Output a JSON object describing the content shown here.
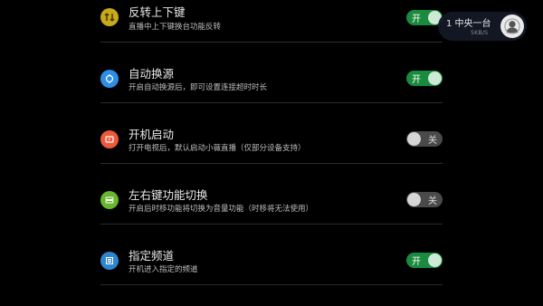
{
  "settings": {
    "items": [
      {
        "title": "反转上下键",
        "desc": "直播中上下键换台功能反转",
        "state": "开",
        "on": true,
        "icon": "reverse-icon",
        "color": "#c8a918"
      },
      {
        "title": "自动换源",
        "desc": "开启自动换源后，即可设置连接超时时长",
        "state": "开",
        "on": true,
        "icon": "auto-switch-source-icon",
        "color": "#2d8ee8"
      },
      {
        "title": "开机启动",
        "desc": "打开电视后，默认启动小薇直播（仅部分设备支持）",
        "state": "关",
        "on": false,
        "icon": "boot-start-icon",
        "color": "#ec5a3a"
      },
      {
        "title": "左右键功能切换",
        "desc": "开启后时移功能将切换为音量功能（时移将无法使用）",
        "state": "关",
        "on": false,
        "icon": "left-right-key-icon",
        "color": "#69b52e"
      },
      {
        "title": "指定频道",
        "desc": "开机进入指定的频道",
        "state": "开",
        "on": true,
        "icon": "channel-list-icon",
        "color": "#2f86cf"
      }
    ]
  },
  "overlay": {
    "channel": "1  中央一台",
    "speed": "5KB/S",
    "avatar_icon": "avatar-icon"
  }
}
